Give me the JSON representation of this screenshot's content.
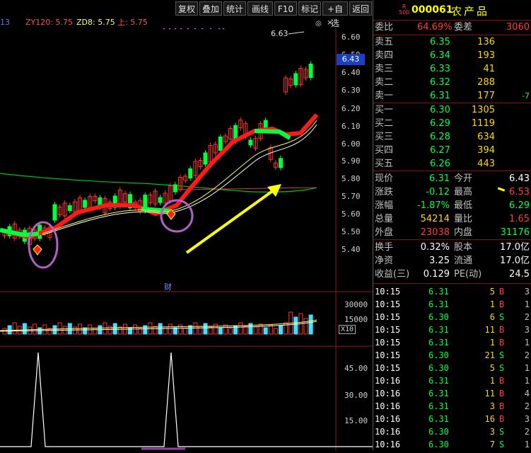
{
  "toolbar": {
    "buttons": [
      "复权",
      "叠加",
      "统计",
      "画线",
      "F10",
      "标记",
      "+自选",
      "返回"
    ]
  },
  "indicator": {
    "prefix": "13",
    "zy120": "ZY120: 5.75",
    "zd8": "ZD8: 5.75",
    "up": "上: 5.75"
  },
  "chart": {
    "price_axis": [
      "6.60",
      "6.50",
      "6.40",
      "6.30",
      "6.20",
      "6.10",
      "6.00",
      "5.90",
      "5.80",
      "5.70",
      "5.60",
      "5.50",
      "5.40"
    ],
    "current_price_tag": "6.43",
    "high_label": "6.63",
    "finance_marker": "财",
    "volume_axis": [
      "30000",
      "15000"
    ],
    "volume_unit": "X10",
    "osc_axis": [
      "45.00",
      "30.00",
      "15.00"
    ],
    "colors": {
      "up": "#ff3030",
      "down": "#00ff3c",
      "ma_green": "#00c000",
      "arrow": "#ffff00",
      "circle": "#b060c0"
    }
  },
  "panel": {
    "stock_code": "000061",
    "stock_name": "农产品",
    "badge_top": "R",
    "badge_bottom": "500",
    "weibi_label": "委比",
    "weibi_value": "64.69%",
    "weicha_label": "委差",
    "weicha_value": "3060",
    "sell": [
      {
        "label": "卖五",
        "price": "6.35",
        "vol": "136",
        "chg": ""
      },
      {
        "label": "卖四",
        "price": "6.34",
        "vol": "193",
        "chg": ""
      },
      {
        "label": "卖三",
        "price": "6.33",
        "vol": "41",
        "chg": ""
      },
      {
        "label": "卖二",
        "price": "6.32",
        "vol": "288",
        "chg": ""
      },
      {
        "label": "卖一",
        "price": "6.31",
        "vol": "177",
        "chg": "-7"
      }
    ],
    "buy": [
      {
        "label": "买一",
        "price": "6.30",
        "vol": "1305"
      },
      {
        "label": "买二",
        "price": "6.29",
        "vol": "1119"
      },
      {
        "label": "买三",
        "price": "6.28",
        "vol": "634"
      },
      {
        "label": "买四",
        "price": "6.27",
        "vol": "394"
      },
      {
        "label": "买五",
        "price": "6.26",
        "vol": "443"
      }
    ],
    "quote": [
      {
        "l1": "现价",
        "v1": "6.31",
        "c1": "green",
        "l2": "今开",
        "v2": "6.43",
        "c2": "white"
      },
      {
        "l1": "涨跌",
        "v1": "-0.12",
        "c1": "green",
        "l2": "最高",
        "v2": "6.53",
        "c2": "red"
      },
      {
        "l1": "涨幅",
        "v1": "-1.87%",
        "c1": "green",
        "l2": "最低",
        "v2": "6.29",
        "c2": "green"
      },
      {
        "l1": "总量",
        "v1": "54214",
        "c1": "yellow",
        "l2": "量比",
        "v2": "1.65",
        "c2": "red"
      },
      {
        "l1": "外盘",
        "v1": "23038",
        "c1": "red",
        "l2": "内盘",
        "v2": "31176",
        "c2": "green"
      }
    ],
    "stats": [
      {
        "l1": "换手",
        "v1": "0.32%",
        "l2": "股本",
        "v2": "17.0亿"
      },
      {
        "l1": "净资",
        "v1": "3.25",
        "l2": "流通",
        "v2": "17.0亿"
      },
      {
        "l1": "收益(三)",
        "v1": "0.129",
        "l2": "PE(动)",
        "v2": "24.5"
      }
    ],
    "ticks": [
      {
        "time": "10:15",
        "price": "6.31",
        "vol": "5",
        "bs": "B",
        "n": "3"
      },
      {
        "time": "10:15",
        "price": "6.31",
        "vol": "1",
        "bs": "B",
        "n": "1"
      },
      {
        "time": "10:15",
        "price": "6.30",
        "vol": "6",
        "bs": "S",
        "n": "2"
      },
      {
        "time": "10:15",
        "price": "6.31",
        "vol": "11",
        "bs": "B",
        "n": "3"
      },
      {
        "time": "10:15",
        "price": "6.31",
        "vol": "1",
        "bs": "B",
        "n": "1"
      },
      {
        "time": "10:15",
        "price": "6.30",
        "vol": "21",
        "bs": "S",
        "n": "2"
      },
      {
        "time": "10:15",
        "price": "6.30",
        "vol": "5",
        "bs": "S",
        "n": "1"
      },
      {
        "time": "10:16",
        "price": "6.31",
        "vol": "1",
        "bs": "B",
        "n": "1"
      },
      {
        "time": "10:16",
        "price": "6.31",
        "vol": "11",
        "bs": "B",
        "n": "4"
      },
      {
        "time": "10:16",
        "price": "6.31",
        "vol": "3",
        "bs": "B",
        "n": "2"
      },
      {
        "time": "10:16",
        "price": "6.31",
        "vol": "16",
        "bs": "B",
        "n": "3"
      },
      {
        "time": "10:16",
        "price": "6.30",
        "vol": "3",
        "bs": "S",
        "n": "2"
      },
      {
        "time": "10:16",
        "price": "6.30",
        "vol": "7",
        "bs": "S",
        "n": "1"
      }
    ]
  }
}
